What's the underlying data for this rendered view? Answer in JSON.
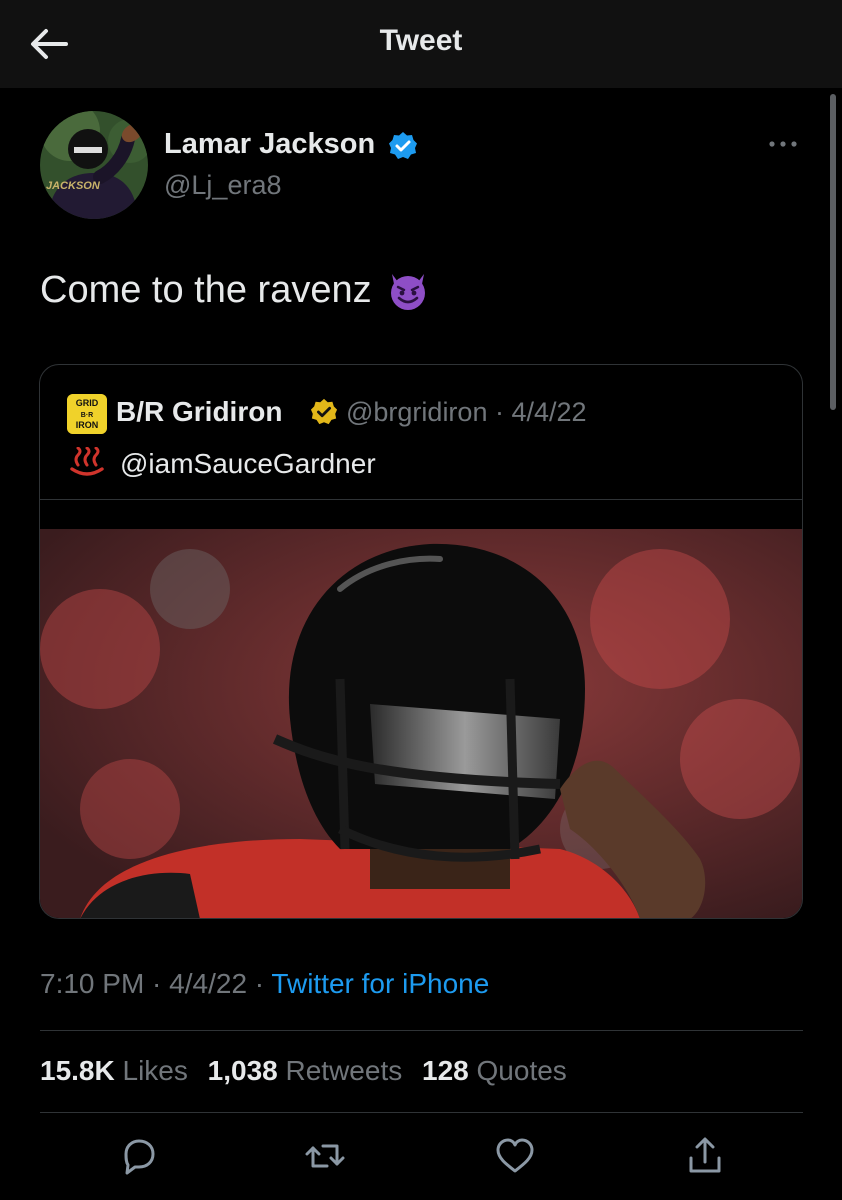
{
  "header": {
    "title": "Tweet",
    "back_icon": "back-arrow-icon"
  },
  "author": {
    "name": "Lamar Jackson",
    "handle": "@Lj_era8",
    "verified": true,
    "avatar_jersey_text": "JACKSON"
  },
  "tweet": {
    "text": "Come to the ravenz",
    "emoji_icon": "smiling-devil-icon"
  },
  "quoted": {
    "logo_text": "GRID B·R IRON",
    "name": "B/R Gridiron",
    "verified_color": "#e2b719",
    "handle": "@brgridiron",
    "separator": "·",
    "date": "4/4/22",
    "text": "@iamSauceGardner",
    "emoji_icon": "hot-springs-icon"
  },
  "meta": {
    "time": "7:10 PM",
    "sep1": " · ",
    "date": "4/4/22",
    "sep2": " · ",
    "source": "Twitter for iPhone"
  },
  "stats": {
    "likes_count": "15.8K",
    "likes_label": "Likes",
    "retweets_count": "1,038",
    "retweets_label": "Retweets",
    "quotes_count": "128",
    "quotes_label": "Quotes"
  },
  "colors": {
    "background": "#000000",
    "text": "#e7e9ea",
    "muted": "#71767b",
    "accent": "#1d9bf0",
    "divider": "#2f3336"
  },
  "actions": [
    "reply-icon",
    "retweet-icon",
    "like-icon",
    "share-icon"
  ]
}
